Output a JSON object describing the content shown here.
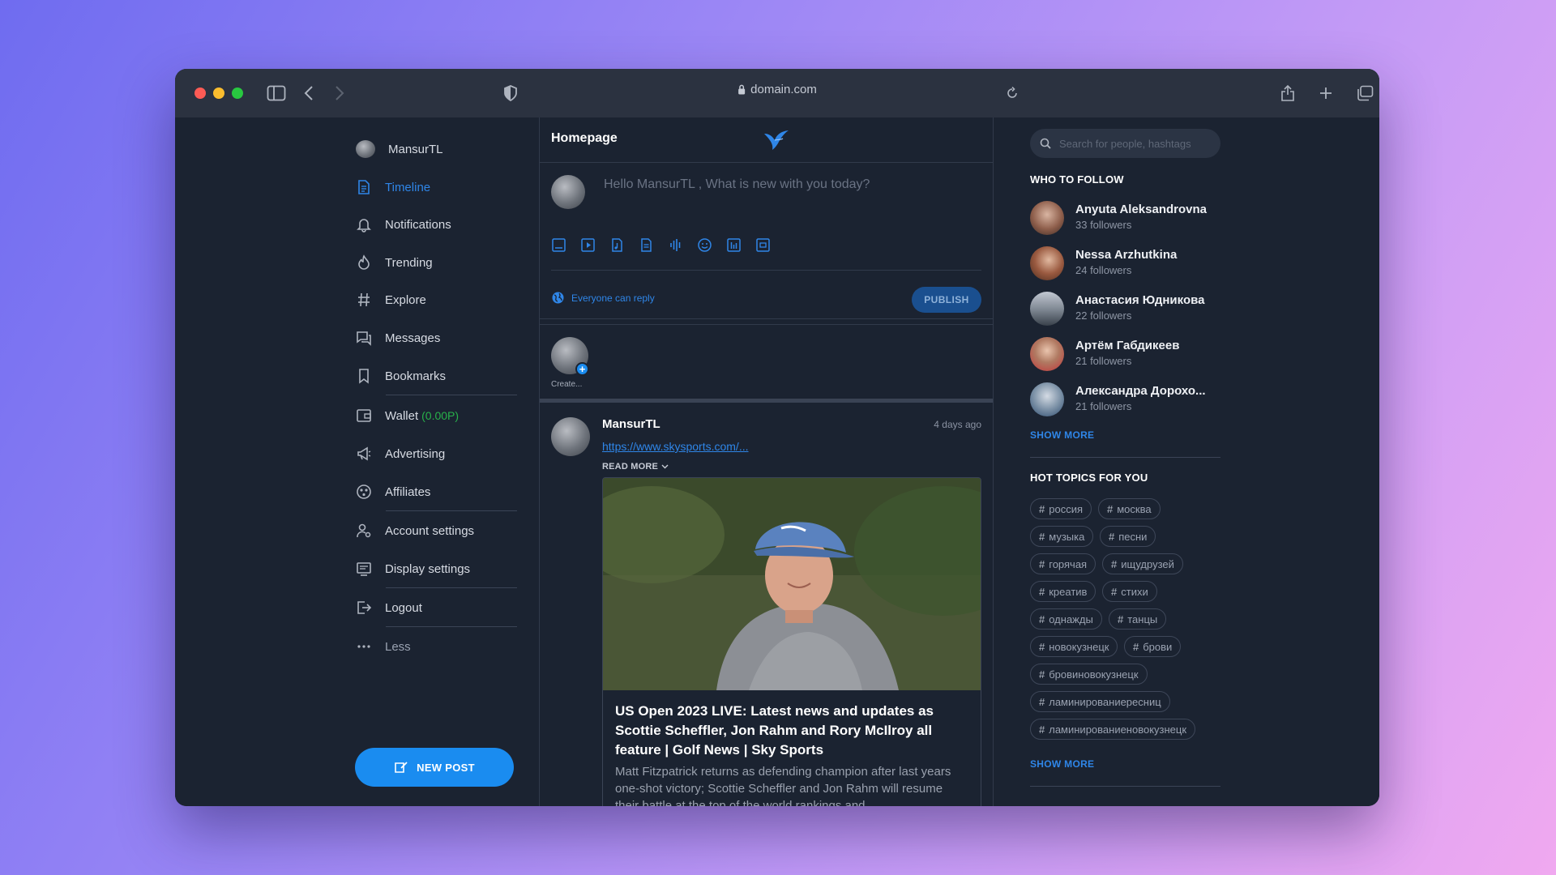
{
  "browser": {
    "url": "domain.com"
  },
  "sidebar": {
    "username": "MansurTL",
    "items": [
      {
        "label": "Timeline"
      },
      {
        "label": "Notifications"
      },
      {
        "label": "Trending"
      },
      {
        "label": "Explore"
      },
      {
        "label": "Messages"
      },
      {
        "label": "Bookmarks"
      },
      {
        "label": "Wallet",
        "amount": "(0.00P)"
      },
      {
        "label": "Advertising"
      },
      {
        "label": "Affiliates"
      },
      {
        "label": "Account settings"
      },
      {
        "label": "Display settings"
      },
      {
        "label": "Logout"
      },
      {
        "label": "Less"
      }
    ],
    "new_post_label": "NEW POST"
  },
  "center": {
    "title": "Homepage",
    "compose_placeholder": "Hello MansurTL , What is new with you today?",
    "reply_setting": "Everyone can reply",
    "publish_label": "PUBLISH",
    "story_label": "Create..."
  },
  "post": {
    "author": "MansurTL",
    "time": "4 days ago",
    "link": "https://www.skysports.com/...",
    "read_more": "READ MORE",
    "card_title": "US Open 2023 LIVE: Latest news and updates as Scottie Scheffler, Jon Rahm and Rory McIlroy all feature | Golf News | Sky Sports",
    "card_desc": "Matt Fitzpatrick returns as defending champion after last years one-shot victory; Scottie Scheffler and Jon Rahm will resume their battle at the top of the world rankings and"
  },
  "right": {
    "search_placeholder": "Search for people, hashtags",
    "who_to_follow_title": "WHO TO FOLLOW",
    "follow": [
      {
        "name": "Anyuta Aleksandrovna",
        "followers": "33 followers"
      },
      {
        "name": "Nessa Arzhutkina",
        "followers": "24 followers"
      },
      {
        "name": "Анастасия Юдникова",
        "followers": "22 followers"
      },
      {
        "name": "Артём Габдикеев",
        "followers": "21 followers"
      },
      {
        "name": "Александра Дорохо...",
        "followers": "21 followers"
      }
    ],
    "show_more_label": "SHOW MORE",
    "hot_topics_title": "HOT TOPICS FOR YOU",
    "tags": [
      "россия",
      "москва",
      "музыка",
      "песни",
      "горячая",
      "ищудрузей",
      "креатив",
      "стихи",
      "однажды",
      "танцы",
      "новокузнецк",
      "брови",
      "бровиновокузнецк",
      "ламинированиересниц",
      "ламинированиеновокузнецк"
    ],
    "show_more_label_2": "SHOW MORE"
  },
  "colors": {
    "accent": "#2f86e8",
    "button": "#1a8cf0",
    "background": "#1b2331",
    "wallet_green": "#28b24a"
  }
}
